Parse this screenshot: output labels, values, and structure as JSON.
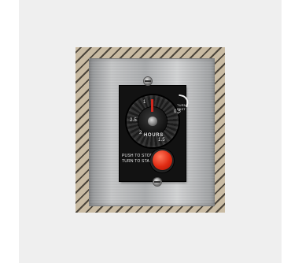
{
  "timer": {
    "scale_labels": {
      "top_left": "1",
      "top_right": "0.5",
      "left": "2.5",
      "bottom_left": "2",
      "bottom_right": "1.5"
    },
    "unit_label": "HOURS",
    "turn_past_label": [
      "TURN",
      "PAST",
      "1"
    ],
    "pointer_color": "#d2281f"
  },
  "instructions": {
    "line1": "PUSH TO STOP",
    "line2": "TURN TO START"
  },
  "stop_button_color": "#e02a12"
}
